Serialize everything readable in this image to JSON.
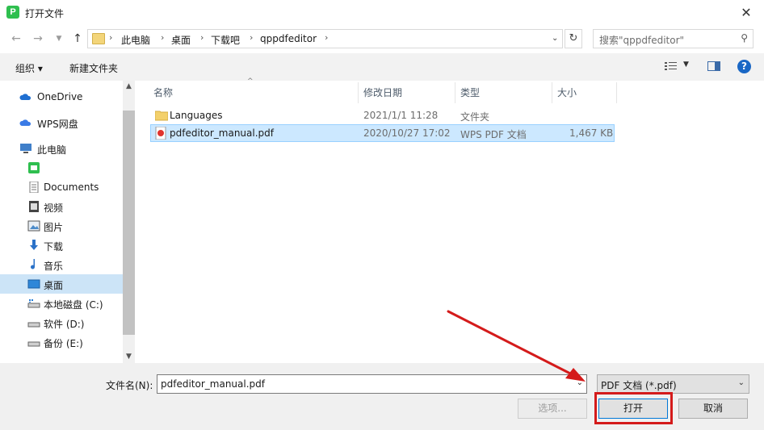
{
  "window": {
    "title": "打开文件",
    "app_icon_letter": "P"
  },
  "address": {
    "crumbs": [
      "此电脑",
      "桌面",
      "下载吧",
      "qppdfeditor"
    ]
  },
  "search": {
    "placeholder": "搜索\"qppdfeditor\""
  },
  "toolbar": {
    "organize": "组织 ▾",
    "new_folder": "新建文件夹"
  },
  "sidebar": {
    "items": [
      {
        "label": "OneDrive",
        "icon": "cloud-icon"
      },
      {
        "label": "WPS网盘",
        "icon": "wps-cloud-icon"
      },
      {
        "label": "此电脑",
        "icon": "computer-icon"
      },
      {
        "label": "",
        "icon": "app-folder-icon"
      },
      {
        "label": "Documents",
        "icon": "documents-icon"
      },
      {
        "label": "视频",
        "icon": "video-icon"
      },
      {
        "label": "图片",
        "icon": "pictures-icon"
      },
      {
        "label": "下载",
        "icon": "download-icon"
      },
      {
        "label": "音乐",
        "icon": "music-icon"
      },
      {
        "label": "桌面",
        "icon": "desktop-icon",
        "selected": true
      },
      {
        "label": "本地磁盘 (C:)",
        "icon": "drive-icon"
      },
      {
        "label": "软件 (D:)",
        "icon": "drive-icon"
      },
      {
        "label": "备份 (E:)",
        "icon": "drive-icon"
      }
    ]
  },
  "columns": {
    "name": "名称",
    "modified": "修改日期",
    "type": "类型",
    "size": "大小"
  },
  "files": [
    {
      "name": "Languages",
      "modified": "2021/1/1 11:28",
      "type": "文件夹",
      "size": "",
      "icon": "folder-icon"
    },
    {
      "name": "pdfeditor_manual.pdf",
      "modified": "2020/10/27 17:02",
      "type": "WPS PDF 文档",
      "size": "1,467 KB",
      "icon": "pdf-icon",
      "selected": true
    }
  ],
  "footer": {
    "filename_label": "文件名(N):",
    "filename_value": "pdfeditor_manual.pdf",
    "filter_value": "PDF 文档 (*.pdf)",
    "options_label": "选项...",
    "open_label": "打开",
    "cancel_label": "取消"
  },
  "colors": {
    "selection": "#cce8ff",
    "highlight_box": "#d41b1b",
    "arrow": "#d41b1b"
  }
}
